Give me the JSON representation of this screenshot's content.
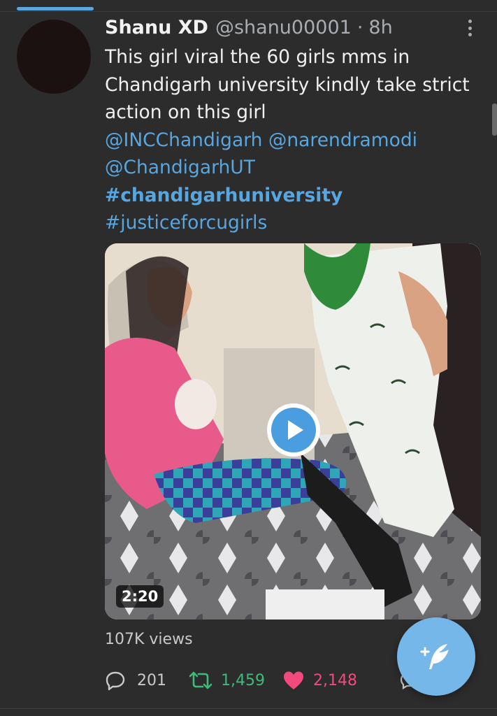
{
  "tweet": {
    "display_name": "Shanu XD",
    "handle": "@shanu00001",
    "separator": "·",
    "time": "8h",
    "text_lines": [
      "This girl viral the 60 girls mms in",
      "Chandigarh university kindly take strict",
      "action on this girl"
    ],
    "mentions_line1": [
      "@INCChandigarh",
      "@narendramodi"
    ],
    "mention_line2": "@ChandigarhUT",
    "hashtag_primary": "#chandigarhuniversity",
    "hashtag_secondary": "#justiceforcugirls",
    "video_duration": "2:20",
    "views": "107K views",
    "reply_count": "201",
    "retweet_count": "1,459",
    "like_count": "2,148"
  },
  "icons": {
    "more": "more-vertical-icon",
    "play": "play-icon",
    "reply": "reply-icon",
    "retweet": "retweet-icon",
    "like": "heart-icon",
    "share": "share-icon",
    "compose": "compose-feather-icon"
  },
  "colors": {
    "background": "#2c2c2c",
    "link": "#58a6e0",
    "retweet": "#3fba7c",
    "like": "#f24a7d",
    "compose": "#76b7ea"
  }
}
